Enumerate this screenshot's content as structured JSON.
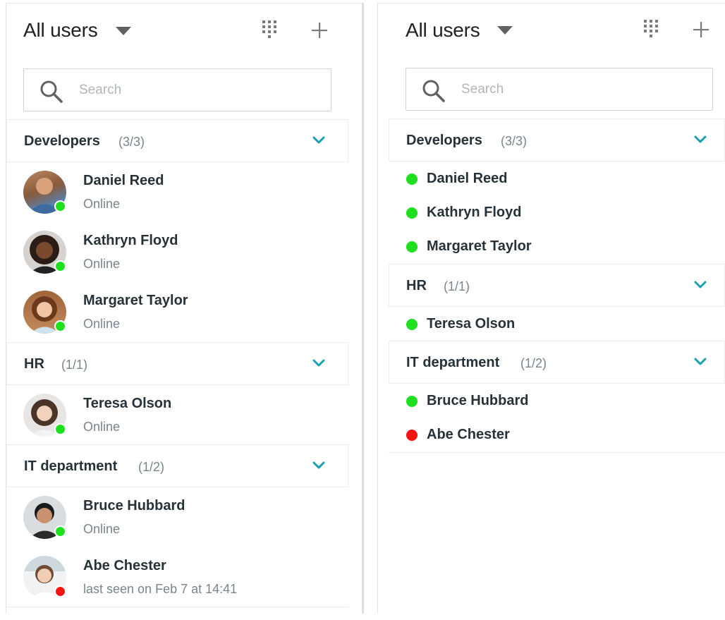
{
  "colors": {
    "online": "#1fe01f",
    "offline": "#f51414",
    "accent": "#1aa0b4",
    "icon_gray": "#7a7a7a"
  },
  "left": {
    "title": "All users",
    "search_placeholder": "Search",
    "groups": [
      {
        "name": "Developers",
        "count": "(3/3)",
        "users": [
          {
            "name": "Daniel Reed",
            "status": "Online",
            "presence": "online"
          },
          {
            "name": "Kathryn Floyd",
            "status": "Online",
            "presence": "online"
          },
          {
            "name": "Margaret Taylor",
            "status": "Online",
            "presence": "online"
          }
        ]
      },
      {
        "name": "HR",
        "count": "(1/1)",
        "users": [
          {
            "name": "Teresa Olson",
            "status": "Online",
            "presence": "online"
          }
        ]
      },
      {
        "name": "IT department",
        "count": "(1/2)",
        "users": [
          {
            "name": "Bruce Hubbard",
            "status": "Online",
            "presence": "online"
          },
          {
            "name": "Abe Chester",
            "status": "last seen on Feb 7 at 14:41",
            "presence": "offline"
          }
        ]
      }
    ]
  },
  "right": {
    "title": "All users",
    "search_placeholder": "Search",
    "groups": [
      {
        "name": "Developers",
        "count": "(3/3)",
        "users": [
          {
            "name": "Daniel Reed",
            "presence": "online"
          },
          {
            "name": "Kathryn Floyd",
            "presence": "online"
          },
          {
            "name": "Margaret Taylor",
            "presence": "online"
          }
        ]
      },
      {
        "name": "HR",
        "count": "(1/1)",
        "users": [
          {
            "name": "Teresa Olson",
            "presence": "online"
          }
        ]
      },
      {
        "name": "IT department",
        "count": "(1/2)",
        "users": [
          {
            "name": "Bruce Hubbard",
            "presence": "online"
          },
          {
            "name": "Abe Chester",
            "presence": "offline"
          }
        ]
      }
    ]
  }
}
